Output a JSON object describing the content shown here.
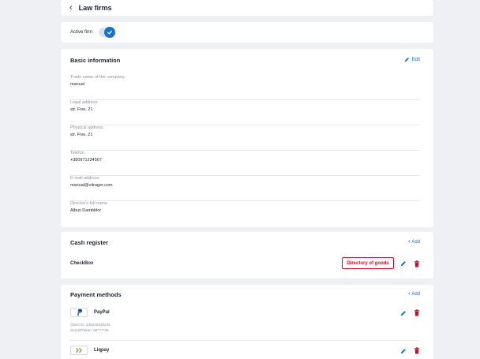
{
  "header": {
    "title": "Law firms"
  },
  "active_firm": {
    "label": "Active firm",
    "checked": true
  },
  "basic_info": {
    "title": "Basic information",
    "edit_label": "Edit",
    "fields": [
      {
        "label": "Trade name of the company",
        "value": "manual"
      },
      {
        "label": "Legal address",
        "value": "str. Five, 21"
      },
      {
        "label": "Physical address",
        "value": "str. Five, 21"
      },
      {
        "label": "Telefon",
        "value": "+380971234567"
      },
      {
        "label": "E-mail address",
        "value": "manual@vitrager.com"
      },
      {
        "label": "Director's full name",
        "value": "Albus Dambldor"
      }
    ]
  },
  "cash_register": {
    "title": "Cash register",
    "add_label": "+ Add",
    "items": [
      {
        "name": "CheckBox",
        "directory_label": "Directory of goods"
      }
    ]
  },
  "payment_methods": {
    "title": "Payment methods",
    "add_label": "+ Add",
    "items": [
      {
        "name": "PayPal",
        "client_id": "Client ID: 245245245245",
        "secret": "Secret/Token: 56*****26"
      },
      {
        "name": "Liqpay"
      }
    ]
  },
  "colors": {
    "accent": "#1673c9",
    "danger": "#c8102e",
    "background": "#eef0f3"
  },
  "icons": [
    "chevron-left-icon",
    "check-icon",
    "pencil-icon",
    "trash-icon",
    "paypal-icon",
    "liqpay-icon"
  ]
}
